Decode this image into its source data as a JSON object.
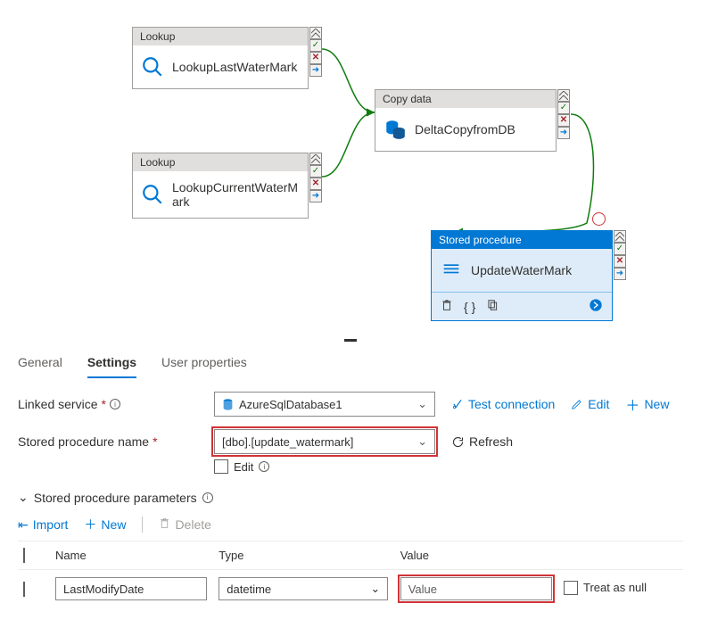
{
  "canvas": {
    "activities": {
      "lookupLast": {
        "type": "Lookup",
        "name": "LookupLastWaterMark"
      },
      "lookupCurrent": {
        "type": "Lookup",
        "name": "LookupCurrentWaterMark"
      },
      "copy": {
        "type": "Copy data",
        "name": "DeltaCopyfromDB"
      },
      "sproc": {
        "type": "Stored procedure",
        "name": "UpdateWaterMark"
      }
    }
  },
  "tabs": {
    "general": "General",
    "settings": "Settings",
    "userprops": "User properties"
  },
  "form": {
    "linkedServiceLabel": "Linked service",
    "linkedServiceValue": "AzureSqlDatabase1",
    "testConnection": "Test connection",
    "edit": "Edit",
    "new": "New",
    "sprocLabel": "Stored procedure name",
    "sprocValue": "[dbo].[update_watermark]",
    "refresh": "Refresh",
    "editCheckbox": "Edit"
  },
  "params": {
    "sectionTitle": "Stored procedure parameters",
    "import": "Import",
    "new": "New",
    "delete": "Delete",
    "cols": {
      "name": "Name",
      "type": "Type",
      "value": "Value"
    },
    "row": {
      "name": "LastModifyDate",
      "type": "datetime",
      "value": "Value",
      "treatAsNull": "Treat as null"
    }
  }
}
